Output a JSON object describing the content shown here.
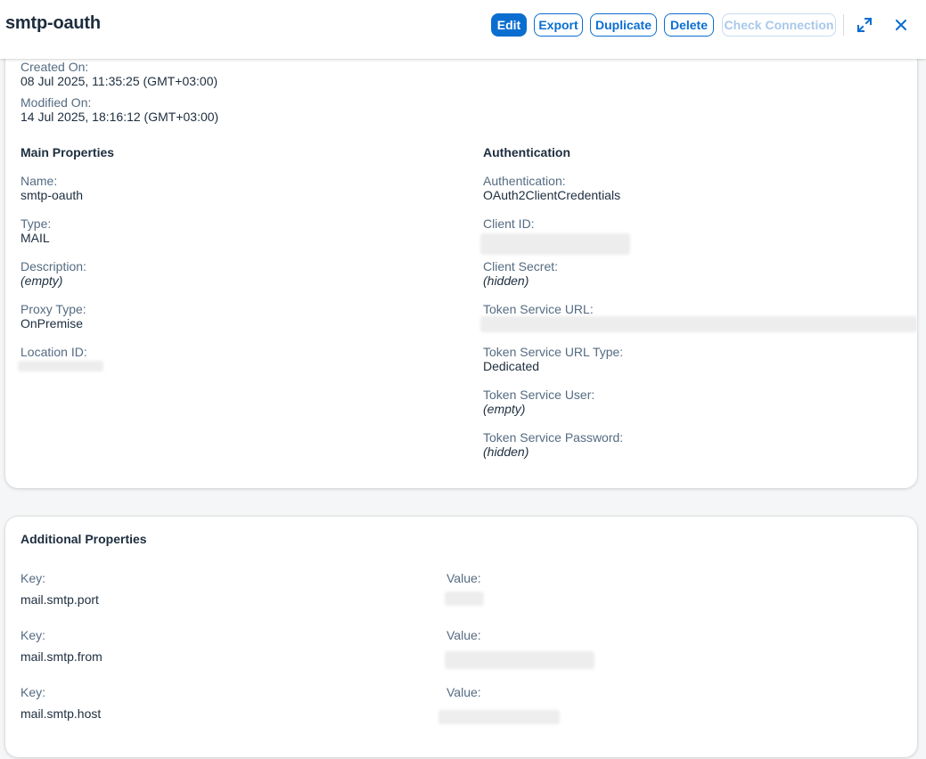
{
  "header": {
    "title": "smtp-oauth",
    "buttons": {
      "edit": "Edit",
      "export": "Export",
      "duplicate": "Duplicate",
      "delete": "Delete",
      "check_connection": "Check Connection"
    },
    "icons": {
      "fullscreen": "fullscreen-icon",
      "close": "close-icon"
    }
  },
  "meta": {
    "created_label": "Created On:",
    "created_value": "08 Jul 2025, 11:35:25 (GMT+03:00)",
    "modified_label": "Modified On:",
    "modified_value": "14 Jul 2025, 18:16:12 (GMT+03:00)"
  },
  "main_properties": {
    "heading": "Main Properties",
    "name_label": "Name:",
    "name_value": "smtp-oauth",
    "type_label": "Type:",
    "type_value": "MAIL",
    "description_label": "Description:",
    "description_value": "(empty)",
    "proxy_label": "Proxy Type:",
    "proxy_value": "OnPremise",
    "location_label": "Location ID:"
  },
  "authentication": {
    "heading": "Authentication",
    "auth_label": "Authentication:",
    "auth_value": "OAuth2ClientCredentials",
    "client_id_label": "Client ID:",
    "client_secret_label": "Client Secret:",
    "client_secret_value": "(hidden)",
    "token_url_label": "Token Service URL:",
    "token_url_type_label": "Token Service URL Type:",
    "token_url_type_value": "Dedicated",
    "token_user_label": "Token Service User:",
    "token_user_value": "(empty)",
    "token_password_label": "Token Service Password:",
    "token_password_value": "(hidden)"
  },
  "additional_properties": {
    "heading": "Additional Properties",
    "key_label": "Key:",
    "value_label": "Value:",
    "rows": [
      {
        "key": "mail.smtp.port"
      },
      {
        "key": "mail.smtp.from"
      },
      {
        "key": "mail.smtp.host"
      }
    ]
  },
  "colors": {
    "accent": "#0a6ed1",
    "label": "#556b82",
    "text": "#1d2d3e",
    "background": "#f5f6f7"
  }
}
